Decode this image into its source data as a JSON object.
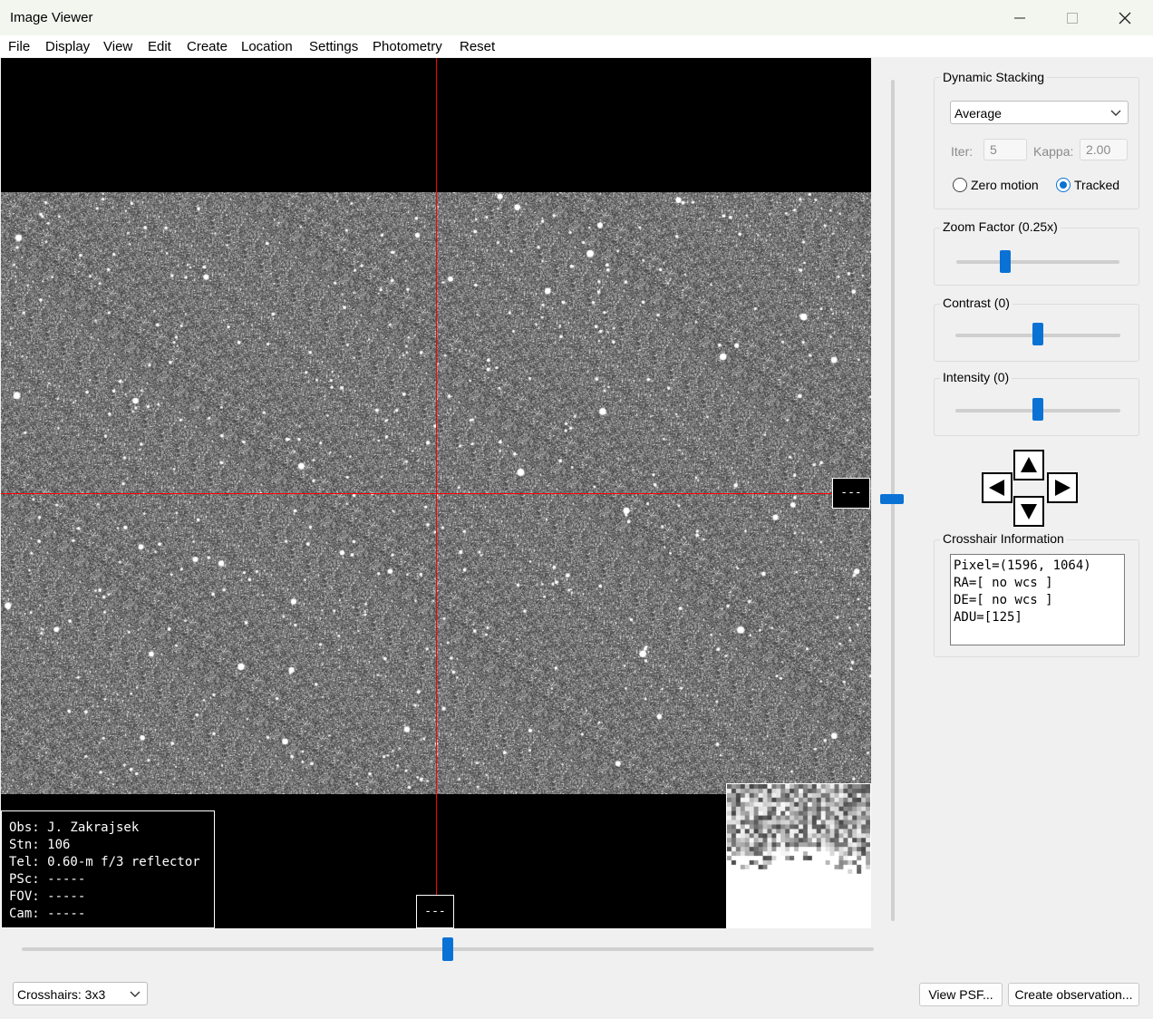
{
  "window": {
    "title": "Image Viewer",
    "controls": {
      "minimize": "minimize-icon",
      "maximize": "maximize-icon",
      "close": "close-icon"
    }
  },
  "menu": [
    "File",
    "Display",
    "View",
    "Edit",
    "Create",
    "Location",
    "Settings",
    "Photometry",
    "Reset"
  ],
  "viewer": {
    "right_readout": "---",
    "bottom_readout": "---",
    "obs_info": [
      "Obs: J. Zakrajsek",
      "Stn: 106",
      "Tel: 0.60-m f/3 reflector",
      "PSc: -----",
      "FOV: -----",
      "Cam: -----"
    ],
    "crosshair_color": "#ff0000"
  },
  "vertical_slider_value": 0.5,
  "horizontal_slider_value": 0.5,
  "dynamic_stacking": {
    "label": "Dynamic Stacking",
    "method": "Average",
    "iter_label": "Iter:",
    "iter_value": "5",
    "kappa_label": "Kappa:",
    "kappa_value": "2.00",
    "zero_motion_label": "Zero motion",
    "tracked_label": "Tracked",
    "selected": "tracked"
  },
  "zoom": {
    "label": "Zoom Factor (0.25x)",
    "value": 0.3
  },
  "contrast": {
    "label": "Contrast (0)",
    "value": 0.5
  },
  "intensity": {
    "label": "Intensity (0)",
    "value": 0.5
  },
  "pan_buttons": {
    "up": "up-arrow-icon",
    "down": "down-arrow-icon",
    "left": "left-arrow-icon",
    "right": "right-arrow-icon"
  },
  "crosshair_info": {
    "label": "Crosshair Information",
    "lines": [
      "Pixel=(1596, 1064)",
      "RA=[ no wcs ]",
      "DE=[ no wcs ]",
      "ADU=[125]"
    ]
  },
  "crosshairs_select": "Crosshairs: 3x3",
  "buttons": {
    "view_psf": "View PSF...",
    "create_obs": "Create observation..."
  },
  "accent_color": "#0a72d4"
}
